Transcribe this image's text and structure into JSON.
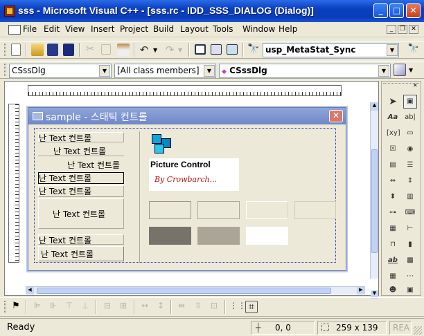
{
  "window": {
    "title": "sss - Microsoft Visual C++ - [sss.rc - IDD_SSS_DIALOG (Dialog)]"
  },
  "menu": [
    "File",
    "Edit",
    "View",
    "Insert",
    "Project",
    "Build",
    "Layout",
    "Tools",
    "Window",
    "Help"
  ],
  "toolbar": {
    "function_combo": "usp_MetaStat_Sync"
  },
  "wizardbar": {
    "class_combo": "CSssDlg",
    "filter_combo": "[All class members]",
    "member_combo": "CSssDlg"
  },
  "dialog": {
    "title": "sample - 스태틱 컨트롤",
    "statics": [
      "난 Text 컨트롤",
      "난 Text 컨트롤",
      "난 Text 컨트롤",
      "난 Text 컨트롤",
      "난 Text 컨트롤",
      "난 Text 컨트롤",
      "난 Text 컨트롤",
      "난 Text 컨트롤"
    ],
    "picture_label": "Picture Control",
    "signature": "By Crowbarch..."
  },
  "colors": {
    "title_active": "#0a3fc0",
    "dialog_title": "#7b92cf",
    "swatch_dark": "#77726a",
    "swatch_mid": "#aba597",
    "swatch_white": "#ffffff",
    "accent_icon": "#0aa8d8"
  },
  "status": {
    "text": "Ready",
    "position": "0, 0",
    "size": "259 x 139",
    "mode": "REA"
  }
}
